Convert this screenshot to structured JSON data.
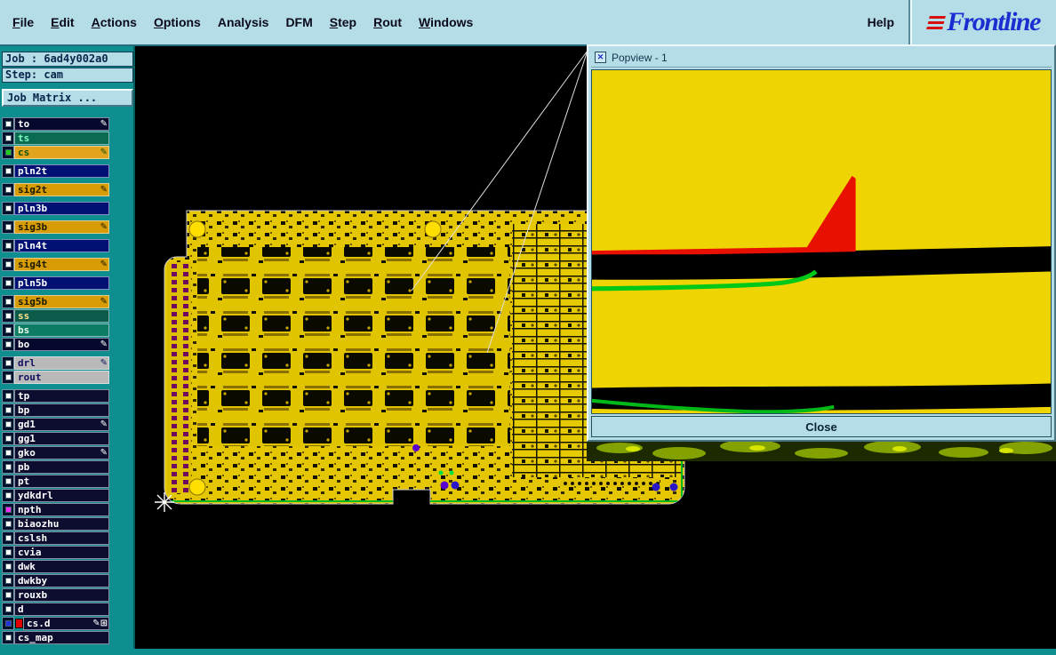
{
  "menu": {
    "items": [
      {
        "label": "File",
        "u": true
      },
      {
        "label": "Edit",
        "u": true
      },
      {
        "label": "Actions",
        "u": true
      },
      {
        "label": "Options",
        "u": true
      },
      {
        "label": "Analysis",
        "u": false
      },
      {
        "label": "DFM",
        "u": false
      },
      {
        "label": "Step",
        "u": true
      },
      {
        "label": "Rout",
        "u": true
      },
      {
        "label": "Windows",
        "u": true
      }
    ],
    "help": "Help",
    "brand": "Frontline"
  },
  "sidebar": {
    "job": "Job : 6ad4y002a0",
    "step": "Step: cam",
    "matrix": "Job Matrix ...",
    "layers": [
      {
        "name": "to",
        "bg": "#06082e",
        "fg": "#ffffff",
        "chk": "#ffffff",
        "icon": "✎"
      },
      {
        "name": "ts",
        "bg": "#0b6b52",
        "fg": "#7dfabe",
        "chk": "#ffffff"
      },
      {
        "name": "cs",
        "bg": "#e2a41c",
        "fg": "#14500a",
        "chk": "#1fcc1f",
        "icon": "✎"
      },
      {
        "name": "pln2t",
        "bg": "#001073",
        "fg": "#ffffff",
        "chk": "#ffffff"
      },
      {
        "name": "sig2t",
        "bg": "#d89c07",
        "fg": "#1a1a00",
        "chk": "#ffffff",
        "icon": "✎"
      },
      {
        "name": "pln3b",
        "bg": "#001073",
        "fg": "#ffffff",
        "chk": "#ffffff"
      },
      {
        "name": "sig3b",
        "bg": "#d89c07",
        "fg": "#1a1a00",
        "chk": "#ffffff",
        "icon": "✎"
      },
      {
        "name": "pln4t",
        "bg": "#001073",
        "fg": "#ffffff",
        "chk": "#ffffff"
      },
      {
        "name": "sig4t",
        "bg": "#d89c07",
        "fg": "#1a1a00",
        "chk": "#ffffff",
        "icon": "✎"
      },
      {
        "name": "pln5b",
        "bg": "#001073",
        "fg": "#ffffff",
        "chk": "#ffffff"
      },
      {
        "name": "sig5b",
        "bg": "#d89c07",
        "fg": "#1a1a00",
        "chk": "#ffffff",
        "icon": "✎"
      },
      {
        "name": "ss",
        "bg": "#0b5b4b",
        "fg": "#ffe08a",
        "chk": "#ffffff"
      },
      {
        "name": "bs",
        "bg": "#0e7c64",
        "fg": "#eaffea",
        "chk": "#ffffff"
      },
      {
        "name": "bo",
        "bg": "#06082e",
        "fg": "#ffffff",
        "chk": "#ffffff",
        "icon": "✎"
      },
      {
        "name": "drl",
        "bg": "#b9b9b9",
        "fg": "#101060",
        "chk": "#ffffff",
        "icon": "✎"
      },
      {
        "name": "rout",
        "bg": "#b9b9b9",
        "fg": "#101060",
        "chk": "#ffffff"
      },
      {
        "name": "tp",
        "bg": "#0d0d30",
        "fg": "#ffffff",
        "chk": "#ffffff"
      },
      {
        "name": "bp",
        "bg": "#0d0d30",
        "fg": "#ffffff",
        "chk": "#ffffff"
      },
      {
        "name": "gd1",
        "bg": "#0d0d30",
        "fg": "#ffffff",
        "chk": "#ffffff",
        "icon": "✎"
      },
      {
        "name": "gg1",
        "bg": "#0d0d30",
        "fg": "#ffffff",
        "chk": "#ffffff"
      },
      {
        "name": "gko",
        "bg": "#0d0d30",
        "fg": "#ffffff",
        "chk": "#ffffff",
        "icon": "✎"
      },
      {
        "name": "pb",
        "bg": "#0d0d30",
        "fg": "#ffffff",
        "chk": "#ffffff"
      },
      {
        "name": "pt",
        "bg": "#0d0d30",
        "fg": "#ffffff",
        "chk": "#ffffff"
      },
      {
        "name": "ydkdrl",
        "bg": "#0d0d30",
        "fg": "#ffffff",
        "chk": "#ffffff"
      },
      {
        "name": "npth",
        "bg": "#0d0d30",
        "fg": "#ffffff",
        "chk": "#ff2bff"
      },
      {
        "name": "biaozhu",
        "bg": "#0d0d30",
        "fg": "#ffffff",
        "chk": "#ffffff"
      },
      {
        "name": "cslsh",
        "bg": "#0d0d30",
        "fg": "#ffffff",
        "chk": "#ffffff"
      },
      {
        "name": "cvia",
        "bg": "#0d0d30",
        "fg": "#ffffff",
        "chk": "#ffffff"
      },
      {
        "name": "dwk",
        "bg": "#0d0d30",
        "fg": "#ffffff",
        "chk": "#ffffff"
      },
      {
        "name": "dwkby",
        "bg": "#0d0d30",
        "fg": "#ffffff",
        "chk": "#ffffff"
      },
      {
        "name": "rouxb",
        "bg": "#0d0d30",
        "fg": "#ffffff",
        "chk": "#ffffff"
      },
      {
        "name": "d",
        "bg": "#0d0d30",
        "fg": "#ffffff",
        "chk": "#ffffff"
      },
      {
        "name": "cs.d",
        "bg": "#0d0d30",
        "fg": "#ffffff",
        "chk": "#2233dd",
        "swatch": "#e00000",
        "icon": "✎⊞"
      },
      {
        "name": "cs_map",
        "bg": "#0d0d30",
        "fg": "#ffffff",
        "chk": "#ffffff"
      }
    ]
  },
  "popview": {
    "title": "Popview - 1",
    "window_icon": "✕",
    "close": "Close"
  },
  "colors": {
    "teal": "#0e8e8e",
    "panel_blue": "#b5dde8",
    "board_yellow": "#e4c702",
    "pop_yellow": "#eed403",
    "pop_red": "#e81000",
    "pop_green": "#00c818",
    "canvas_black": "#000000"
  }
}
